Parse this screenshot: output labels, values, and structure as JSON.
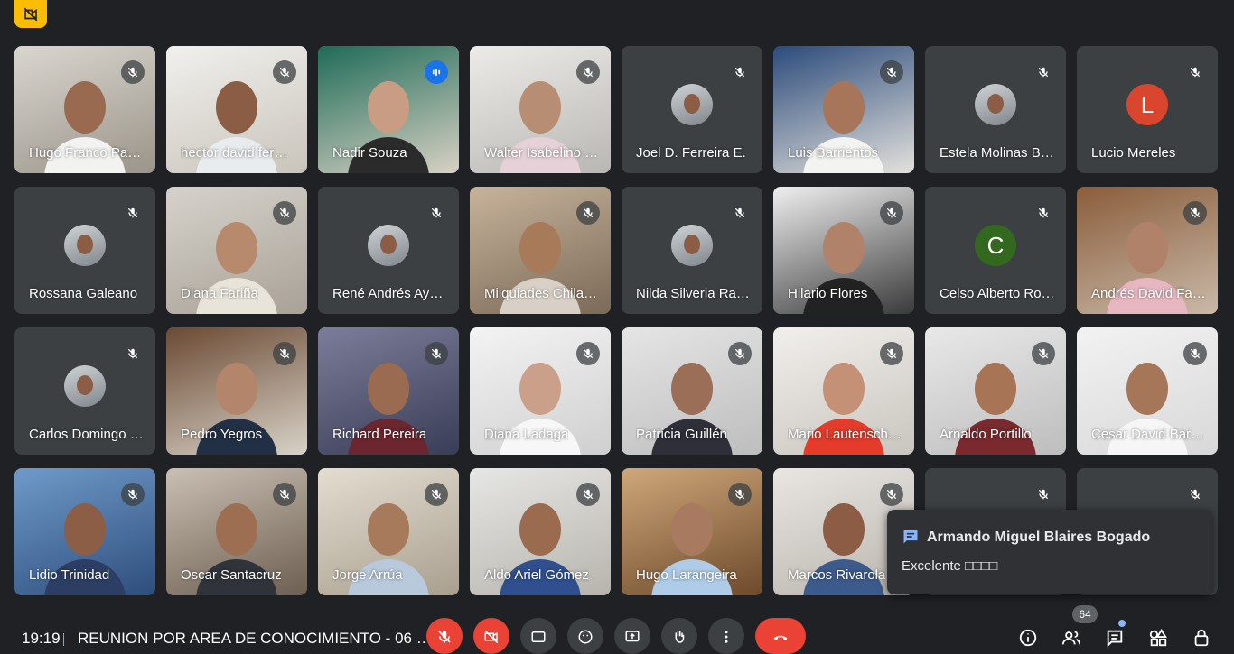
{
  "participants": [
    {
      "name": "Hugo Franco Paa…",
      "kind": "video",
      "c1": "#d9d6cf",
      "c2": "#9b948a",
      "skin": "#9a6a50",
      "shirt": "#f2f2f0"
    },
    {
      "name": "hector david fer…",
      "kind": "video",
      "c1": "#f1f0ed",
      "c2": "#c9c4bb",
      "skin": "#8a5d44",
      "shirt": "#e9ecef"
    },
    {
      "name": "Nadir Souza",
      "kind": "video",
      "speaking": true,
      "c1": "#1f6b57",
      "c2": "#d8d1c4",
      "skin": "#c99c84",
      "shirt": "#2b2b2b"
    },
    {
      "name": "Walter Isabelino …",
      "kind": "video",
      "c1": "#ecebe8",
      "c2": "#b9b7b3",
      "skin": "#b78e74",
      "shirt": "#e6d1d8"
    },
    {
      "name": "Joel D. Ferreira E.",
      "kind": "avatar-photo"
    },
    {
      "name": "Luis Barrientos",
      "kind": "video",
      "c1": "#2c4b7b",
      "c2": "#e3e1dc",
      "skin": "#a7765a",
      "shirt": "#f3f3f1"
    },
    {
      "name": "Estela Molinas B…",
      "kind": "avatar-photo"
    },
    {
      "name": "Lucio Mereles",
      "kind": "avatar-letter",
      "letter": "L",
      "color": "#d9462d"
    },
    {
      "name": "Rossana Galeano",
      "kind": "avatar-photo"
    },
    {
      "name": "Diana Fariña",
      "kind": "video",
      "c1": "#d6d2cb",
      "c2": "#a8a197",
      "skin": "#b88a6d",
      "shirt": "#e9e4da"
    },
    {
      "name": "René Andrés Ayo…",
      "kind": "avatar-photo"
    },
    {
      "name": "Milquiades Chila…",
      "kind": "video",
      "c1": "#c7b39b",
      "c2": "#7b6a58",
      "skin": "#a77a5a",
      "shirt": "#d8d0c6"
    },
    {
      "name": "Nilda Silveria Ra…",
      "kind": "avatar-photo"
    },
    {
      "name": "Hilario Flores",
      "kind": "video",
      "c1": "#efefef",
      "c2": "#3a3a3a",
      "skin": "#b1826a",
      "shirt": "#222222"
    },
    {
      "name": "Celso Alberto Ro…",
      "kind": "avatar-letter",
      "letter": "C",
      "color": "#33691e"
    },
    {
      "name": "Andrés David Fa…",
      "kind": "video",
      "c1": "#8a5d3b",
      "c2": "#c9b9a8",
      "skin": "#b0826a",
      "shirt": "#e6b7c1"
    },
    {
      "name": "Carlos Domingo …",
      "kind": "avatar-photo"
    },
    {
      "name": "Pedro Yegros",
      "kind": "video",
      "c1": "#6b4a33",
      "c2": "#d8d2c8",
      "skin": "#b3856b",
      "shirt": "#223046"
    },
    {
      "name": "Richard Pereira",
      "kind": "video",
      "c1": "#7c7d9a",
      "c2": "#3a3d57",
      "skin": "#9a6b50",
      "shirt": "#6b2630"
    },
    {
      "name": "Diana Ladaga",
      "kind": "video",
      "c1": "#f3f3f3",
      "c2": "#cfcfcf",
      "skin": "#caa08a",
      "shirt": "#f7f7f7"
    },
    {
      "name": "Patricia Guillén",
      "kind": "video",
      "c1": "#e5e5e5",
      "c2": "#bdbdbd",
      "skin": "#9a6e57",
      "shirt": "#2f2f3a"
    },
    {
      "name": "Mario Lautenschl…",
      "kind": "video",
      "c1": "#f1efec",
      "c2": "#c9c5be",
      "skin": "#c49076",
      "shirt": "#e43b2b"
    },
    {
      "name": "Arnaldo Portillo",
      "kind": "video",
      "c1": "#e8e8e8",
      "c2": "#bdbdbd",
      "skin": "#a77556",
      "shirt": "#7a2a2e"
    },
    {
      "name": "Cesar David Bar…",
      "kind": "video",
      "c1": "#f2f2f2",
      "c2": "#d8d8d8",
      "skin": "#a67658",
      "shirt": "#f6f6f6"
    },
    {
      "name": "Lidio Trinidad",
      "kind": "video",
      "c1": "#6f9ac9",
      "c2": "#2e4e7d",
      "skin": "#8c5e45",
      "shirt": "#2c3e63"
    },
    {
      "name": "Oscar Santacruz",
      "kind": "video",
      "c1": "#c9bfb2",
      "c2": "#6d5f52",
      "skin": "#9e6e52",
      "shirt": "#30343a"
    },
    {
      "name": "Jorge Arrúa",
      "kind": "video",
      "c1": "#e3ddd0",
      "c2": "#a99f8f",
      "skin": "#a87a5c",
      "shirt": "#b8c9dc"
    },
    {
      "name": "Aldo Ariel Gómez",
      "kind": "video",
      "c1": "#e6e6e4",
      "c2": "#b7b4ad",
      "skin": "#9b6b50",
      "shirt": "#2f4f8f"
    },
    {
      "name": "Hugo Larangeira",
      "kind": "video",
      "c1": "#cfa77a",
      "c2": "#6d4a2b",
      "skin": "#a87a5f",
      "shirt": "#aecbe8"
    },
    {
      "name": "Marcos Rivarola",
      "kind": "video",
      "c1": "#e9e6e2",
      "c2": "#b9b4ad",
      "skin": "#8c5d44",
      "shirt": "#3d5a8c"
    },
    {
      "name": "",
      "kind": "dark"
    },
    {
      "name": "",
      "kind": "dark"
    }
  ],
  "chat_toast": {
    "sender": "Armando Miguel Blaires Bogado",
    "message": "Excelente □□□□"
  },
  "bottom_bar": {
    "time": "19:19",
    "meeting_title": "REUNION POR AREA DE CONOCIMIENTO - 06 …",
    "participant_count": "64"
  },
  "colors": {
    "background": "#202124",
    "tile": "#3c4043",
    "speaking": "#8ab4f8",
    "danger": "#ea4335",
    "badge": "#fbbc04"
  }
}
